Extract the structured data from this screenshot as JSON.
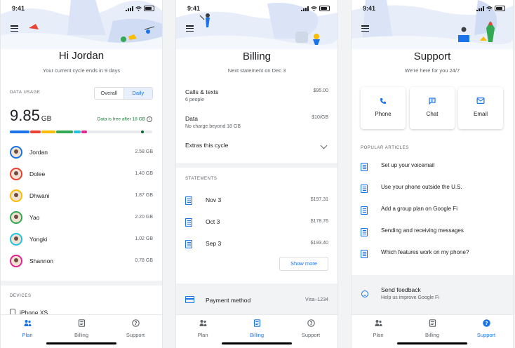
{
  "status_bar": {
    "time": "9:41"
  },
  "plan_screen": {
    "greeting": "Hi Jordan",
    "cycle_note": "Your current cycle ends in 9 days",
    "data_usage_label": "DATA USAGE",
    "toggle": {
      "overall": "Overall",
      "daily": "Daily",
      "selected": "Daily"
    },
    "total_value": "9.85",
    "total_unit": "GB",
    "free_note": "Data is free after 18 GB",
    "usage_fraction": 0.547,
    "segment_colors": [
      "#1a73e8",
      "#ea4335",
      "#fbbc04",
      "#34a853",
      "#24c1e0",
      "#e52592"
    ],
    "users": [
      {
        "name": "Jordan",
        "usage": "2.58 GB",
        "ring": "#1a73e8"
      },
      {
        "name": "Dolee",
        "usage": "1.40 GB",
        "ring": "#ea4335"
      },
      {
        "name": "Dhwani",
        "usage": "1.87 GB",
        "ring": "#fbbc04"
      },
      {
        "name": "Yao",
        "usage": "2.20 GB",
        "ring": "#34a853"
      },
      {
        "name": "Yongki",
        "usage": "1.02 GB",
        "ring": "#24c1e0"
      },
      {
        "name": "Shannon",
        "usage": "0.78 GB",
        "ring": "#e52592"
      }
    ],
    "devices_label": "DEVICES",
    "device_name": "iPhone XS"
  },
  "billing_screen": {
    "title": "Billing",
    "next_statement": "Next statement on Dec 3",
    "items": [
      {
        "label": "Calls & texts",
        "sub": "6 people",
        "amount": "$95.00"
      },
      {
        "label": "Data",
        "sub": "No charge beyond 18 GB",
        "amount": "$10/GB"
      }
    ],
    "extras_label": "Extras this cycle",
    "statements_label": "STATEMENTS",
    "statements": [
      {
        "date": "Nov 3",
        "amount": "$197.31"
      },
      {
        "date": "Oct 3",
        "amount": "$178.76"
      },
      {
        "date": "Sep 3",
        "amount": "$193.40"
      }
    ],
    "show_more": "Show more",
    "payment_label": "Payment method",
    "payment_value": "Visa–1234"
  },
  "support_screen": {
    "title": "Support",
    "subtitle": "We’re here for you 24/7",
    "contact_options": [
      {
        "label": "Phone",
        "icon": "phone-icon"
      },
      {
        "label": "Chat",
        "icon": "chat-icon"
      },
      {
        "label": "Email",
        "icon": "email-icon"
      }
    ],
    "articles_label": "POPULAR ARTICLES",
    "articles": [
      "Set up your voicemail",
      "Use your phone outside the U.S.",
      "Add a group plan on Google Fi",
      "Sending and receiving messages",
      "Which features work on my phone?"
    ],
    "feedback_title": "Send feedback",
    "feedback_sub": "Help us improve Google Fi"
  },
  "bottom_nav": {
    "items": [
      {
        "label": "Plan",
        "icon": "plan-icon"
      },
      {
        "label": "Billing",
        "icon": "billing-icon"
      },
      {
        "label": "Support",
        "icon": "support-icon"
      }
    ]
  },
  "colors": {
    "accent": "#1a73e8",
    "free_text": "#188038"
  }
}
